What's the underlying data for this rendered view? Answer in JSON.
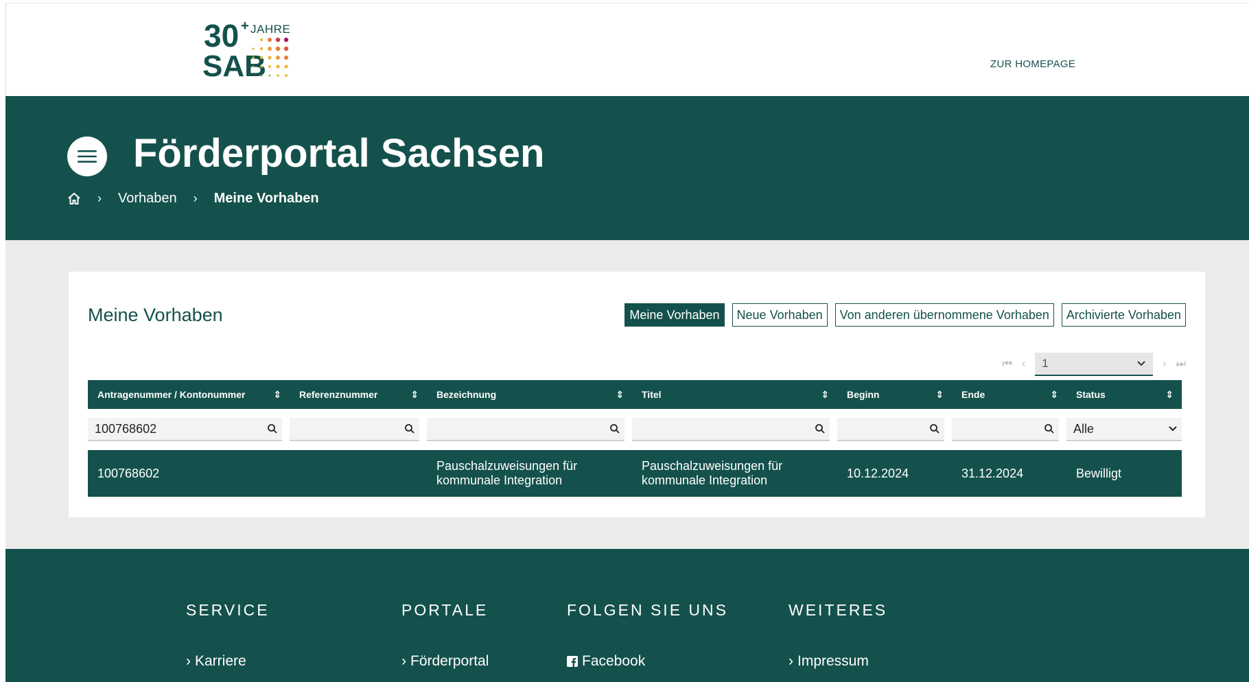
{
  "header": {
    "logo": {
      "number": "30",
      "plus": "+",
      "jahre": "JAHRE",
      "brand": "SAB"
    },
    "homepage_link": "ZUR HOMEPAGE"
  },
  "hero": {
    "title": "Förderportal Sachsen",
    "breadcrumb": {
      "item1": "Vorhaben",
      "current": "Meine Vorhaben"
    }
  },
  "content": {
    "title": "Meine Vorhaben",
    "tabs": [
      "Meine Vorhaben",
      "Neue Vorhaben",
      "Von anderen übernommene Vorhaben",
      "Archivierte Vorhaben"
    ],
    "active_tab": "Meine Vorhaben",
    "pager": {
      "page": "1"
    },
    "columns": [
      "Antragenummer / Kontonummer",
      "Referenznummer",
      "Bezeichnung",
      "Titel",
      "Beginn",
      "Ende",
      "Status"
    ],
    "filters": {
      "antragsnummer": "100768602",
      "status": "Alle"
    },
    "rows": [
      {
        "antragsnummer": "100768602",
        "referenznummer": "",
        "bezeichnung": "Pauschalzuweisungen für kommunale Integration",
        "titel": "Pauschalzuweisungen für kommunale Integration",
        "beginn": "10.12.2024",
        "ende": "31.12.2024",
        "status": "Bewilligt"
      }
    ]
  },
  "footer": {
    "columns": [
      {
        "heading": "SERVICE",
        "link": "Karriere"
      },
      {
        "heading": "PORTALE",
        "link": "Förderportal"
      },
      {
        "heading": "FOLGEN SIE UNS",
        "link": "Facebook"
      },
      {
        "heading": "WEITERES",
        "link": "Impressum"
      }
    ]
  },
  "colors": {
    "primary": "#14514c",
    "background": "#ebebeb"
  }
}
